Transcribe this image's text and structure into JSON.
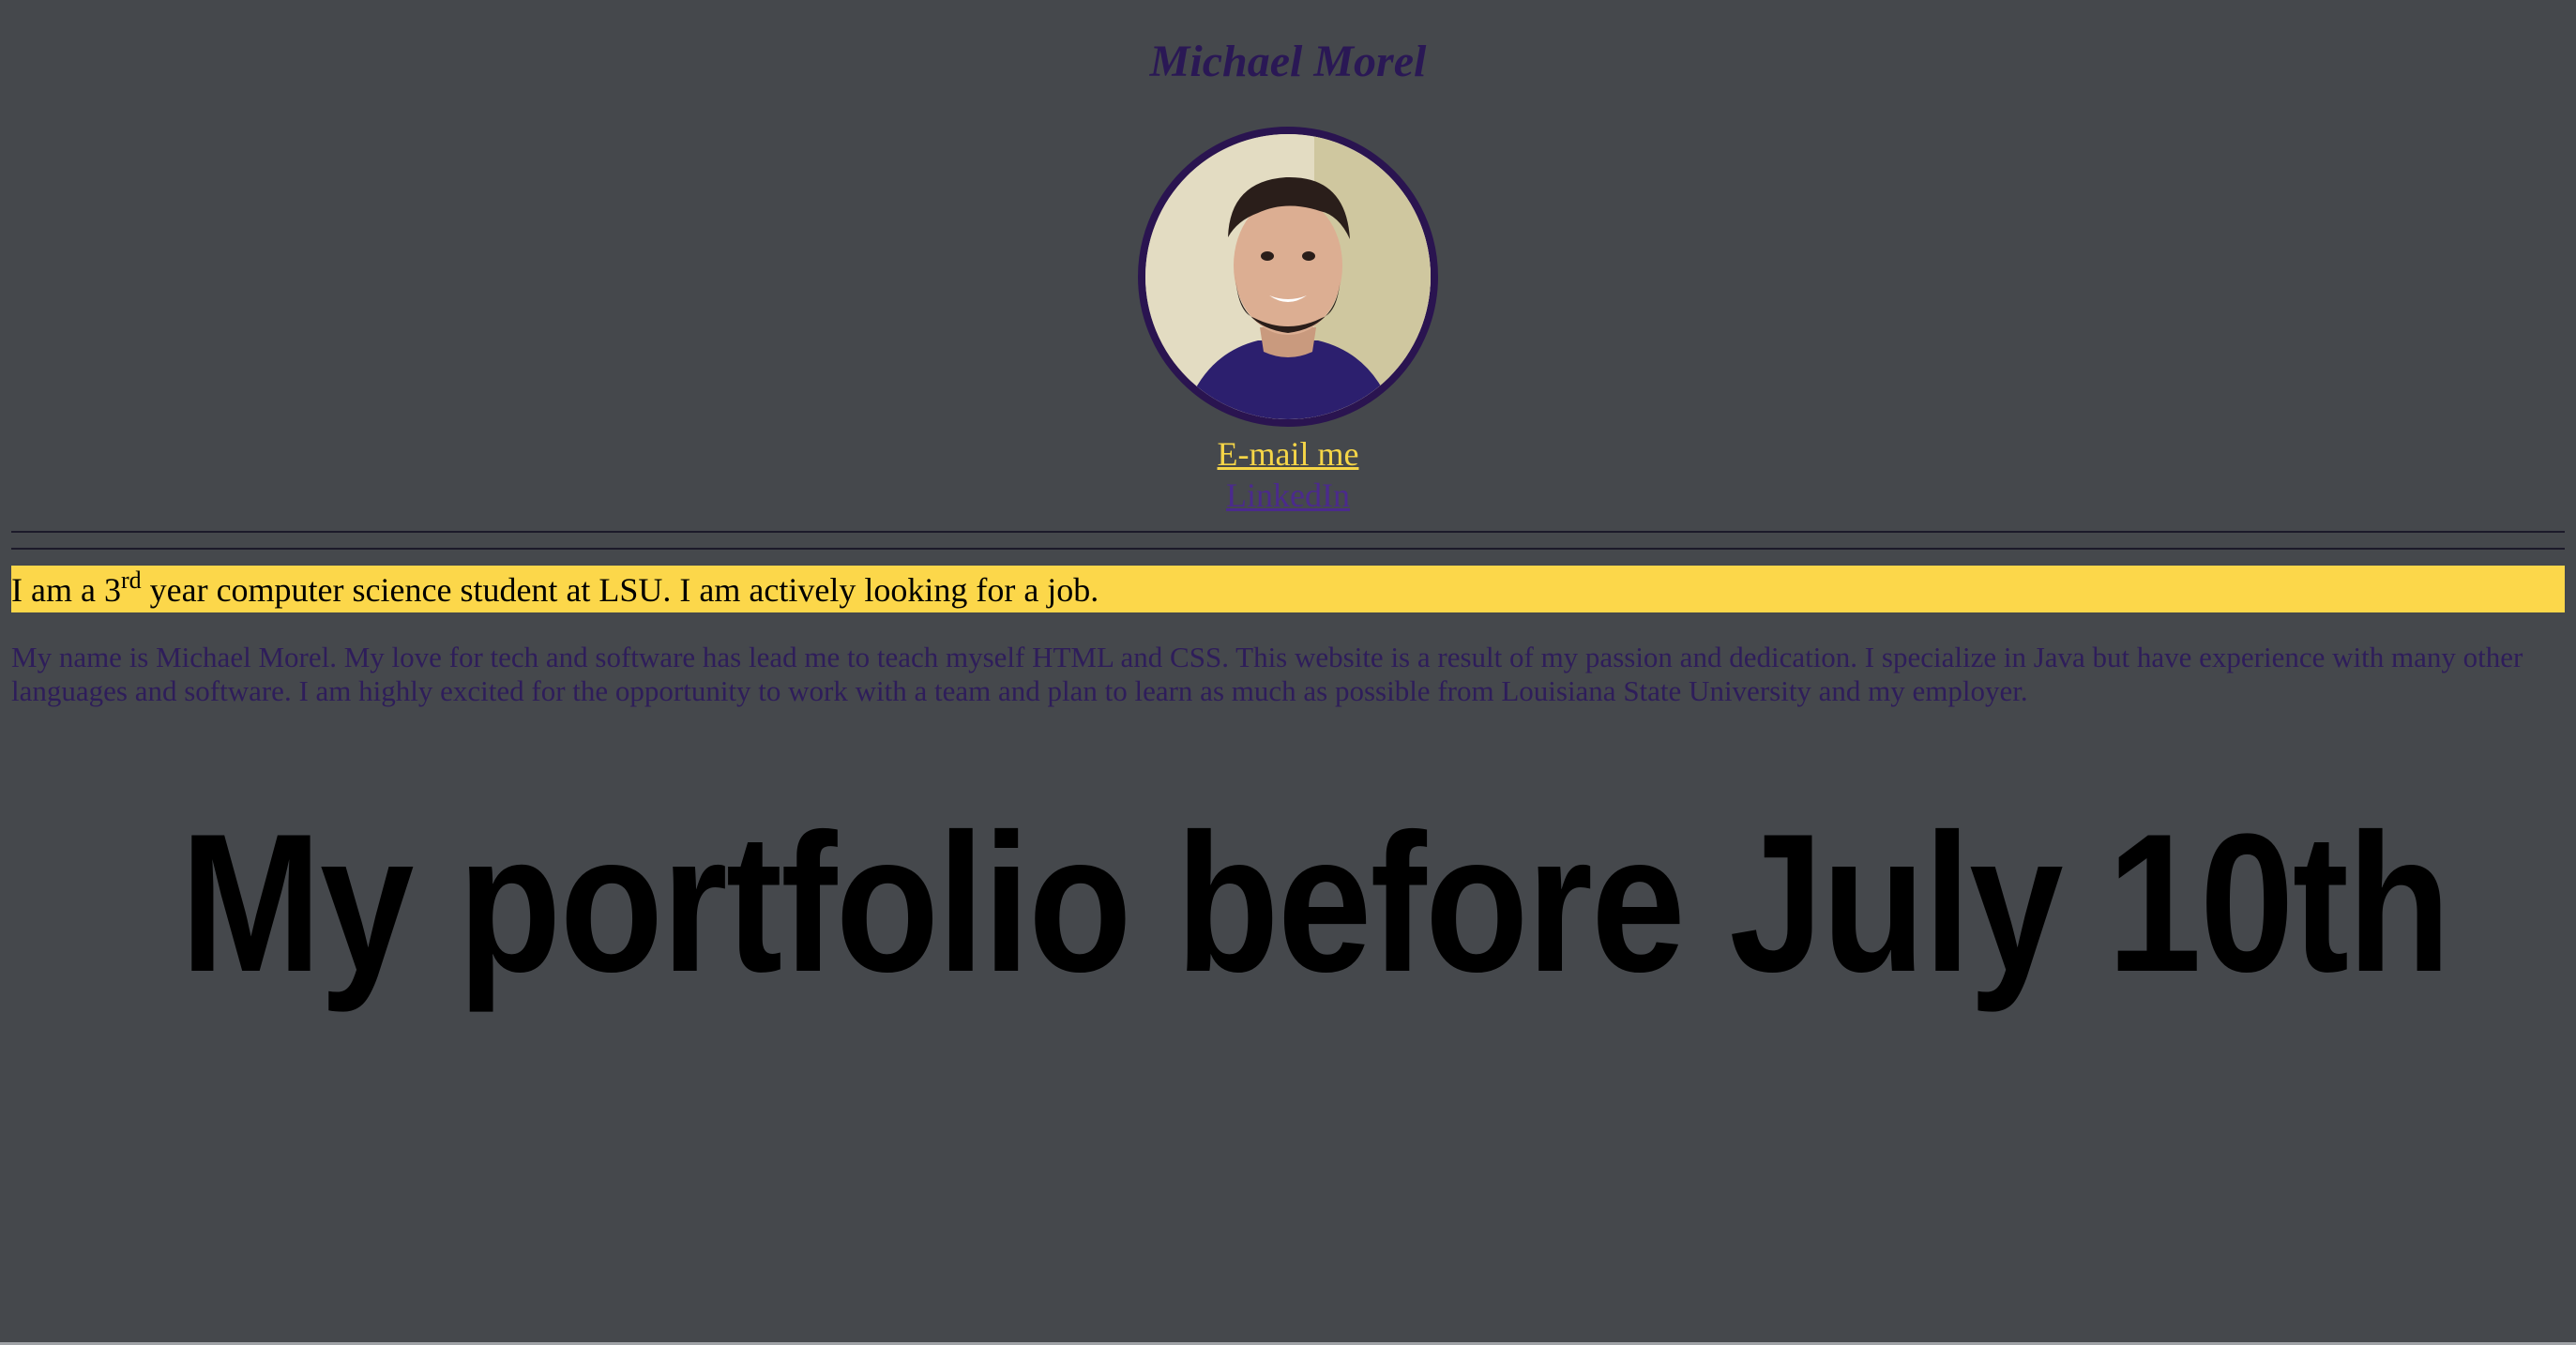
{
  "profile": {
    "name": "Michael Morel",
    "photo": "profile-photo"
  },
  "links": {
    "email_label": "E-mail me",
    "linkedin_label": "LinkedIn"
  },
  "banner": {
    "text_before": "I am a 3",
    "superscript": "rd",
    "text_after": " year computer science student at LSU. I am actively looking for a job."
  },
  "bio": {
    "text": "My name is Michael Morel. My love for tech and software has lead me to teach myself HTML and CSS. This website is a result of my passion and dedication. I specialize in Java but have experience with many other languages and software. I am highly excited for the opportunity to work with a team and plan to learn as much as possible from Louisiana State University and my employer."
  },
  "portfolio": {
    "title": "My portfolio before July 10th"
  },
  "colors": {
    "background": "#45484c",
    "name_purple": "#2a1855",
    "gold": "#fcd74a",
    "link_purple": "#4b2a8c"
  }
}
